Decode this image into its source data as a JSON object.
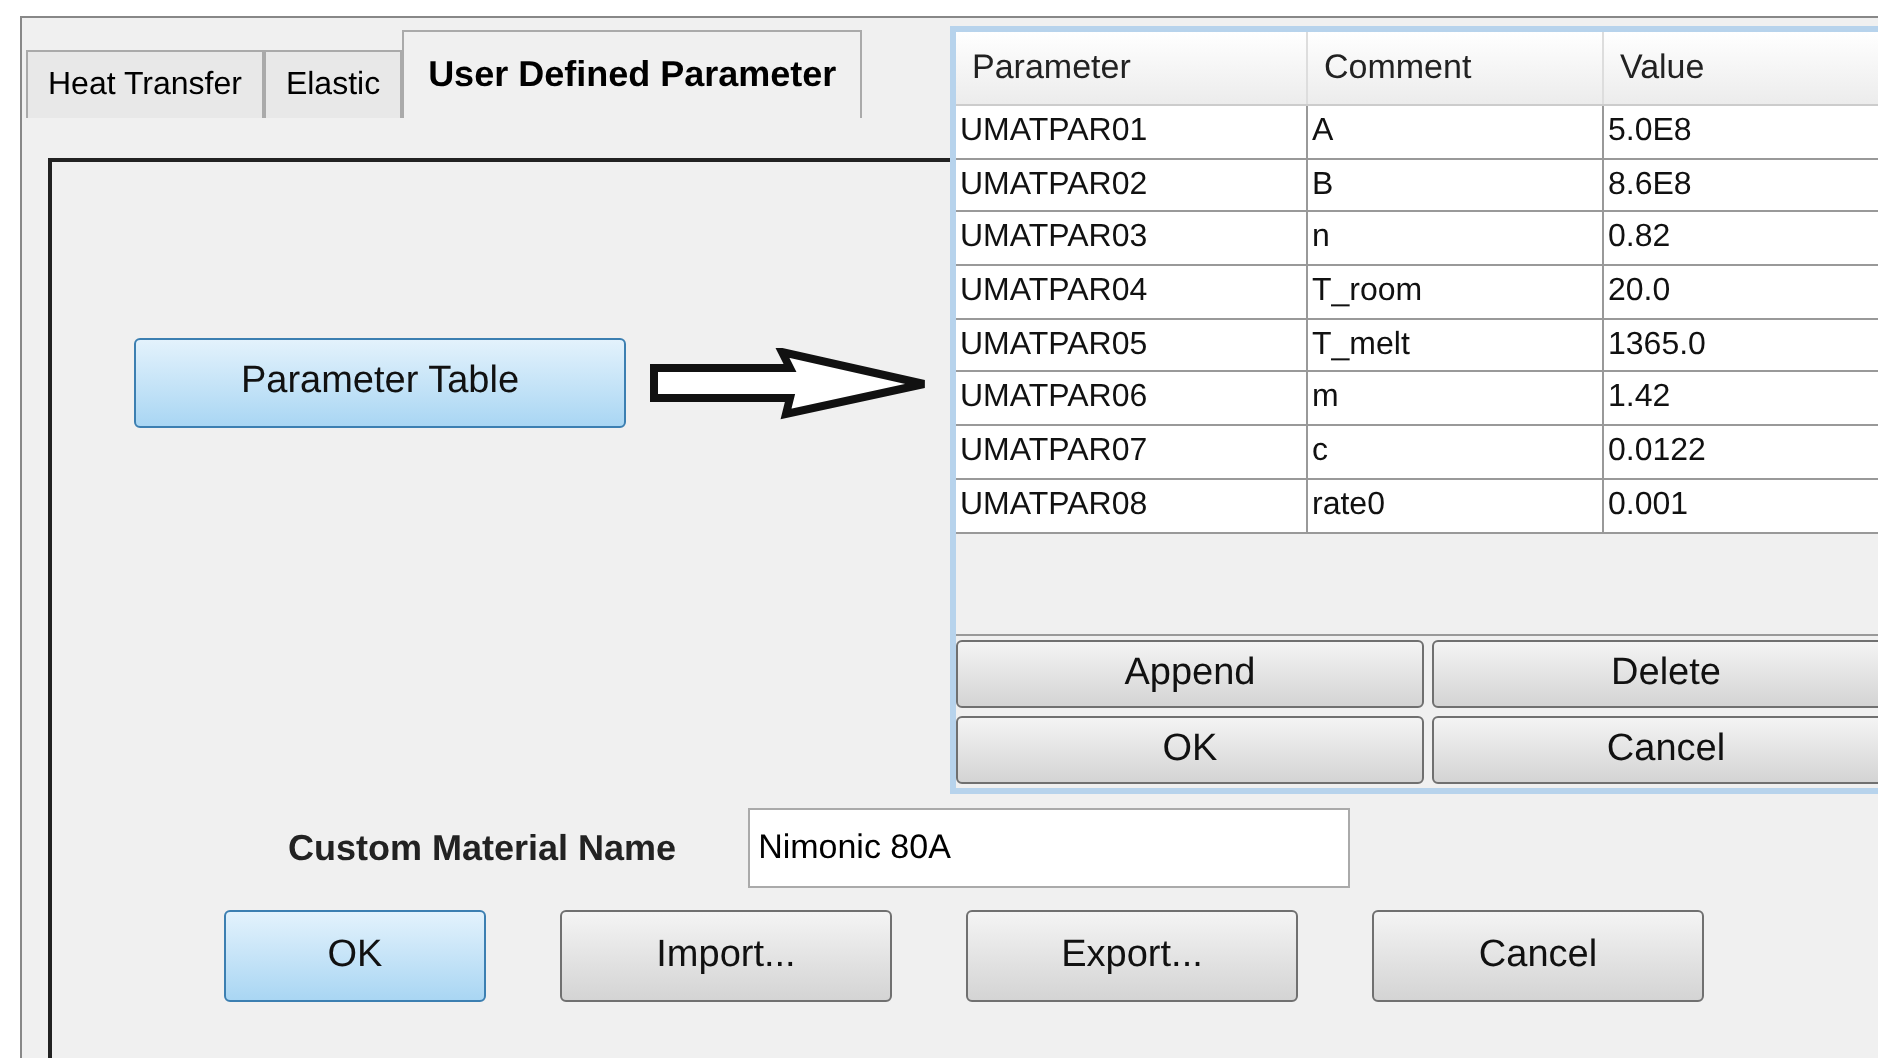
{
  "tabs": [
    {
      "label": "Heat Transfer",
      "selected": false
    },
    {
      "label": "Elastic",
      "selected": false
    },
    {
      "label": "User Defined Parameter",
      "selected": true
    }
  ],
  "parameter_table_button": {
    "label": "Parameter Table",
    "default": true
  },
  "custom_material_name": {
    "label": "Custom Material Name",
    "value": "Nimonic 80A"
  },
  "dialog_buttons": [
    {
      "label": "OK",
      "default": true
    },
    {
      "label": "Import...",
      "default": false
    },
    {
      "label": "Export...",
      "default": false
    },
    {
      "label": "Cancel",
      "default": false
    }
  ],
  "parameter_dialog": {
    "columns": [
      "Parameter",
      "Comment",
      "Value"
    ],
    "rows": [
      [
        "UMATPAR01",
        "A",
        "5.0E8"
      ],
      [
        "UMATPAR02",
        "B",
        "8.6E8"
      ],
      [
        "UMATPAR03",
        "n",
        "0.82"
      ],
      [
        "UMATPAR04",
        "T_room",
        "20.0"
      ],
      [
        "UMATPAR05",
        "T_melt",
        "1365.0"
      ],
      [
        "UMATPAR06",
        "m",
        "1.42"
      ],
      [
        "UMATPAR07",
        "c",
        "0.0122"
      ],
      [
        "UMATPAR08",
        "rate0",
        "0.001"
      ]
    ],
    "buttons": [
      "Append",
      "Delete",
      "OK",
      "Cancel"
    ]
  }
}
